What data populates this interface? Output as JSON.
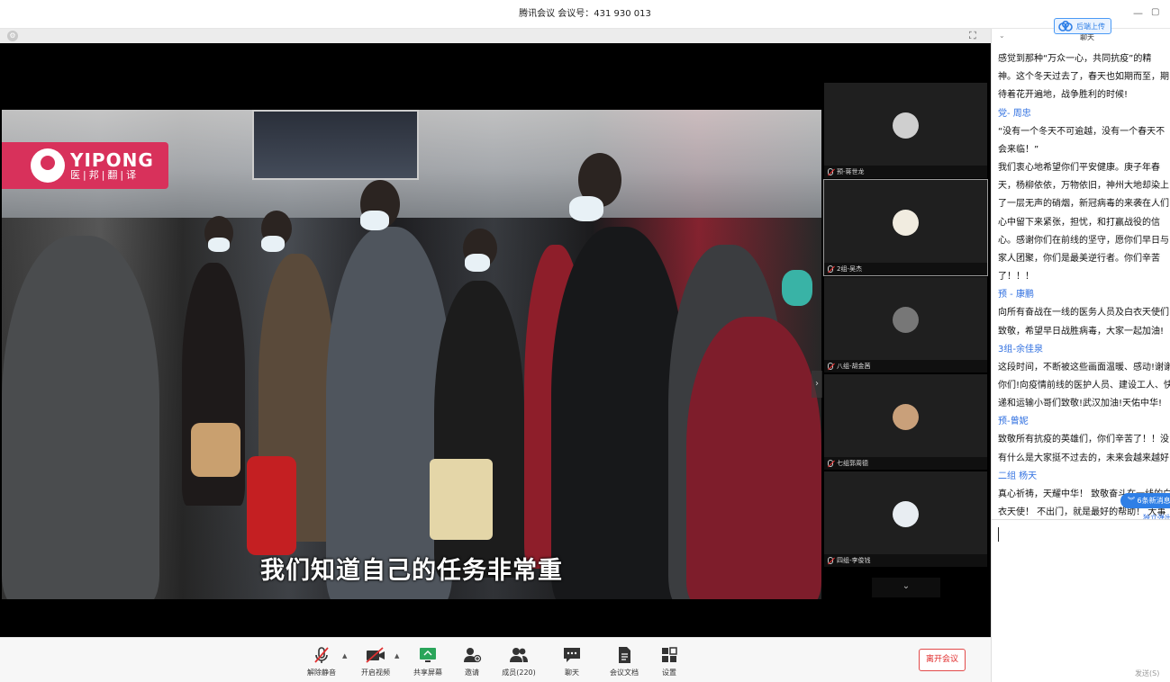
{
  "window": {
    "title": "腾讯会议 会议号：431 930 013",
    "minimize": "—",
    "restore": "▢"
  },
  "upload_button": {
    "label": "后端上传"
  },
  "video": {
    "logo_en": "YIPONG",
    "logo_cn": "医|邦|翻|译",
    "subtitle": "我们知道自己的任务非常重"
  },
  "participants": [
    {
      "name": "预-蒋世龙",
      "avatar_color": "#cfcfcf"
    },
    {
      "name": "2组-吴杰",
      "avatar_color": "#f1ece0"
    },
    {
      "name": "八组-胡金茜",
      "avatar_color": "#777777"
    },
    {
      "name": "七组郭周德",
      "avatar_color": "#c9a07a"
    },
    {
      "name": "四组-李俊钱",
      "avatar_color": "#e8edf2"
    }
  ],
  "toolbar": {
    "items": [
      {
        "key": "mute",
        "label": "解除静音"
      },
      {
        "key": "video",
        "label": "开启视频"
      },
      {
        "key": "share",
        "label": "共享屏幕"
      },
      {
        "key": "invite",
        "label": "邀请"
      },
      {
        "key": "members",
        "label": "成员(220)"
      },
      {
        "key": "chat",
        "label": "聊天"
      },
      {
        "key": "docs",
        "label": "会议文档"
      },
      {
        "key": "settings",
        "label": "设置"
      }
    ],
    "leave": "离开会议"
  },
  "chat": {
    "header": "聊天",
    "messages": [
      {
        "sender": "",
        "lines": [
          "感觉到那种“万众一心，共同抗疫”的精",
          "神。这个冬天过去了，春天也如期而至，期",
          "待着花开遍地，战争胜利的时候!"
        ]
      },
      {
        "sender": "党- 周忠",
        "lines": [
          "“没有一个冬天不可逾越，没有一个春天不",
          "会来临！”",
          "我们衷心地希望你们平安健康。庚子年春",
          "天，杨柳依依，万物依旧，神州大地却染上",
          "了一层无声的硝烟，新冠病毒的来袭在人们",
          "心中留下来紧张，担忧，和打赢战役的信",
          "心。感谢你们在前线的坚守，愿你们早日与",
          "家人团聚，你们是最美逆行者。你们辛苦",
          "了！！！"
        ]
      },
      {
        "sender": "预 - 康鹏",
        "lines": [
          "向所有奋战在一线的医务人员及白衣天使们",
          "致敬，希望早日战胜病毒，大家一起加油!"
        ]
      },
      {
        "sender": "3组-余佳泉",
        "lines": [
          "这段时间，不断被这些画面温暖、感动!谢谢",
          "你们!向疫情前线的医护人员、建设工人、快",
          "递和运输小哥们致敬!武汉加油!天佑中华!"
        ]
      },
      {
        "sender": "预-曾妮",
        "lines": [
          "致敬所有抗疫的英雄们，你们辛苦了！！没",
          "有什么是大家挺不过去的，未来会越来越好"
        ]
      },
      {
        "sender": "二组 杨天",
        "lines": [
          "真心祈祷，天耀中华！ 致敬奋斗在一线的白",
          "衣天使！ 不出门，就是最好的帮助！ 大事"
        ]
      }
    ],
    "new_messages": "︾ 6条新消息",
    "popout": "独立弹出",
    "send": "发送(S)"
  }
}
